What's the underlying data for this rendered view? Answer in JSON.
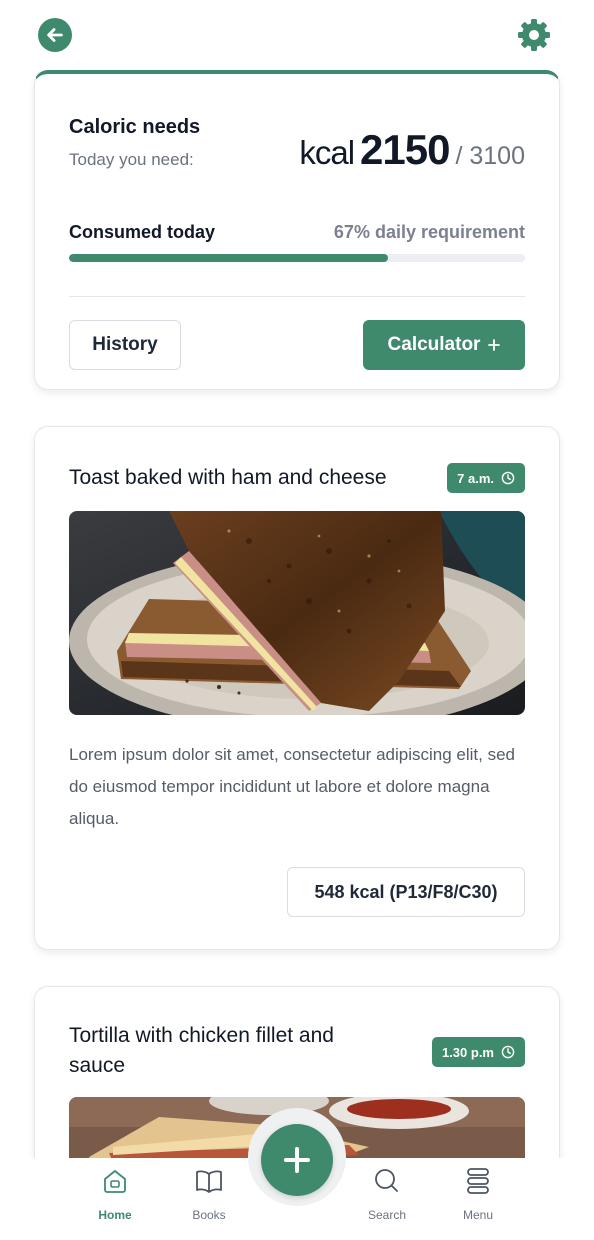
{
  "colors": {
    "accent": "#3f8a6c",
    "track": "#eceef3",
    "muted": "#6b7280"
  },
  "header": {
    "back_icon": "arrow-left-circle-icon",
    "settings_icon": "gear-icon"
  },
  "calories": {
    "title": "Caloric needs",
    "subtitle": "Today you need:",
    "unit": "kcal",
    "needed": "2150",
    "total": "/ 3100",
    "consumed_label": "Consumed today",
    "consumed_percent": "67% daily requirement",
    "progress_fraction": 0.7,
    "history_label": "History",
    "calculator_label": "Calculator",
    "calculator_icon": "plus-icon"
  },
  "meals": [
    {
      "title": "Toast baked with ham and cheese",
      "time": "7 a.m.",
      "time_icon": "clock-icon",
      "description": "Lorem ipsum dolor sit amet, consectetur adipiscing elit, sed do eiusmod tempor incididunt ut labore et dolore magna aliqua.",
      "nutrition": "548 kcal (P13/F8/C30)"
    },
    {
      "title": "Tortilla with chicken fillet and sauce",
      "time": "1.30 p.m",
      "time_icon": "clock-icon"
    }
  ],
  "nav": {
    "items": [
      {
        "label": "Home",
        "icon": "home-icon",
        "active": true
      },
      {
        "label": "Books",
        "icon": "book-icon"
      },
      {
        "label": "Search",
        "icon": "search-icon"
      },
      {
        "label": "Menu",
        "icon": "menu-icon"
      }
    ],
    "fab_icon": "plus-icon"
  }
}
